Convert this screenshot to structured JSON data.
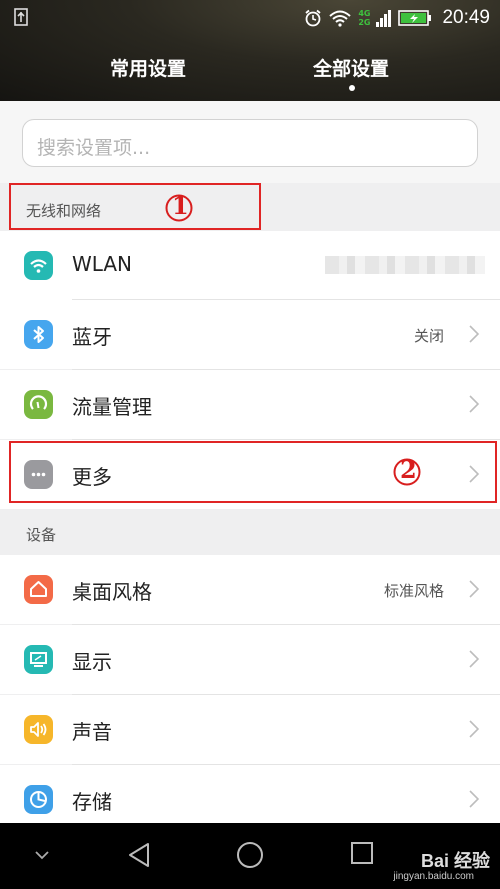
{
  "status_bar": {
    "time": "20:49",
    "network_top": "4G",
    "network_bottom": "2G"
  },
  "header": {
    "tabs": [
      {
        "label": "常用设置",
        "active": false
      },
      {
        "label": "全部设置",
        "active": true
      }
    ]
  },
  "search": {
    "placeholder": "搜索设置项..."
  },
  "sections": {
    "wireless": {
      "title": "无线和网络",
      "items": [
        {
          "label": "WLAN",
          "value": "",
          "icon": "wifi-icon",
          "color": "#25b9b3"
        },
        {
          "label": "蓝牙",
          "value": "关闭",
          "icon": "bluetooth-icon",
          "color": "#46a6ee"
        },
        {
          "label": "流量管理",
          "value": "",
          "icon": "data-usage-icon",
          "color": "#7ab840"
        },
        {
          "label": "更多",
          "value": "",
          "icon": "more-icon",
          "color": "#9a9a9e"
        }
      ]
    },
    "device": {
      "title": "设备",
      "items": [
        {
          "label": "桌面风格",
          "value": "标准风格",
          "icon": "home-icon",
          "color": "#f36a47"
        },
        {
          "label": "显示",
          "value": "",
          "icon": "display-icon",
          "color": "#25b9b3"
        },
        {
          "label": "声音",
          "value": "",
          "icon": "sound-icon",
          "color": "#f6b62a"
        },
        {
          "label": "存储",
          "value": "",
          "icon": "storage-icon",
          "color": "#3fa0e8"
        }
      ]
    }
  },
  "annotations": [
    "1",
    "2"
  ],
  "watermark": {
    "brand": "Bai  经验",
    "url": "jingyan.baidu.com"
  }
}
